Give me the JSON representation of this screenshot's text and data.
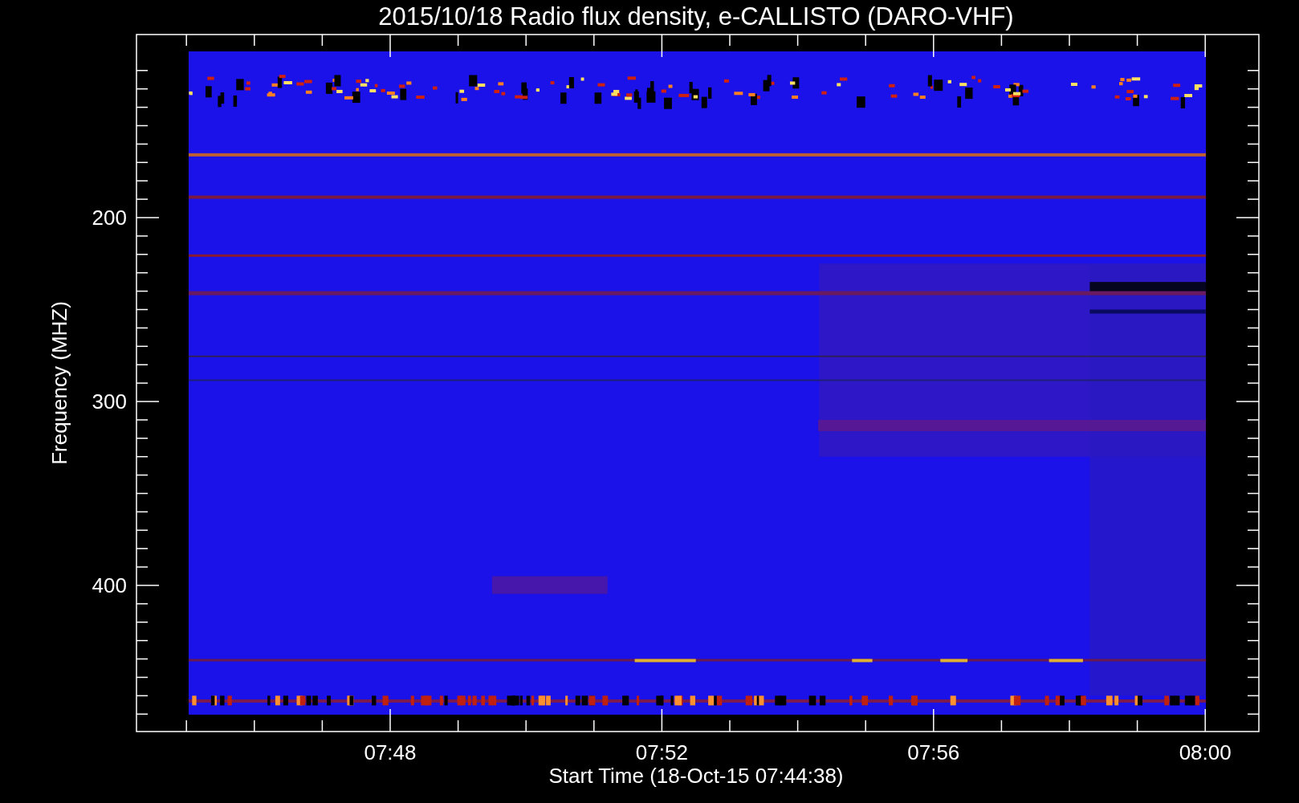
{
  "title": "2015/10/18  Radio flux density, e-CALLISTO (DARO-VHF)",
  "y_axis": {
    "label": "Frequency (MHZ)",
    "ticks": [
      "200",
      "300",
      "400"
    ]
  },
  "x_axis": {
    "label": "Start Time (18-Oct-15 07:44:38)",
    "ticks": [
      "07:48",
      "07:52",
      "07:56",
      "08:00"
    ]
  }
}
